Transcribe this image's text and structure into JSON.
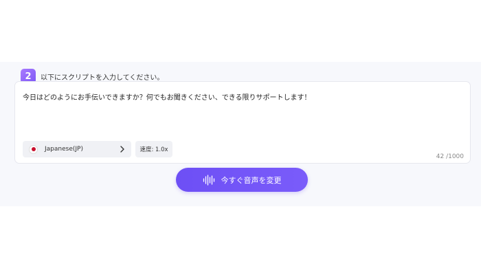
{
  "step": {
    "number": "2",
    "instruction": "以下にスクリプトを入力してください。"
  },
  "editor": {
    "script_text": "今日はどのようにお手伝いできますか？何でもお聞きください、できる限りサポートします！",
    "language_label": "Japanese(JP)",
    "speed_label": "速度: 1.0x",
    "char_count": "42 /1000"
  },
  "convert_button": {
    "label": "今すぐ音声を変更"
  },
  "colors": {
    "accent": "#6d4ff5",
    "badge": "#8b64f8",
    "flag_red": "#c8102e"
  },
  "icons": {
    "flag": "japan-flag-icon",
    "chevron": "chevron-right-icon",
    "wave": "sound-wave-icon"
  }
}
